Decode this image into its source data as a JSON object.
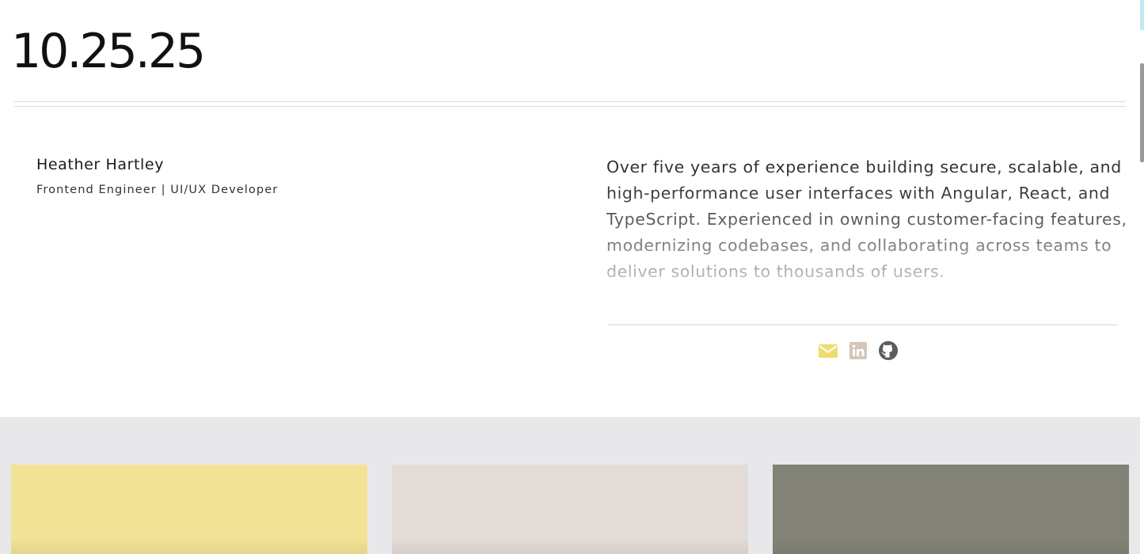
{
  "header": {
    "date": "10.25.25"
  },
  "profile": {
    "name": "Heather Hartley",
    "role": "Frontend Engineer | UI/UX Developer",
    "bio": "Over five years of experience building secure, scalable, and high-performance user interfaces with Angular, React, and TypeScript. Experienced in owning customer-facing features, modernizing codebases, and collaborating across teams to deliver solutions to thousands of users."
  },
  "social_links": [
    {
      "icon": "envelope-icon",
      "color": "#f0dc6e"
    },
    {
      "icon": "linkedin-icon",
      "color": "#d6c6b8"
    },
    {
      "icon": "github-icon",
      "color": "#5d5d5d"
    }
  ],
  "cards": [
    {
      "color": "#f2e295"
    },
    {
      "color": "#e2dbd6"
    },
    {
      "color": "#828276"
    }
  ],
  "colors": {
    "section_background": "#e8e8ea",
    "divider": "#dcdcdc"
  }
}
